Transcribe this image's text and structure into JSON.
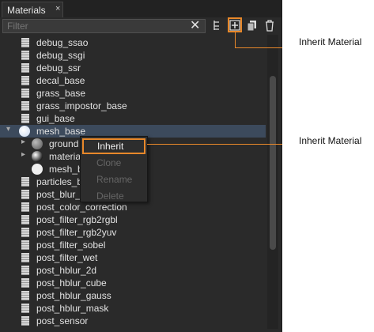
{
  "panel": {
    "tab_title": "Materials",
    "tab_close": "×"
  },
  "filter": {
    "placeholder": "Filter",
    "clear": "✕"
  },
  "materials": [
    {
      "name": "debug_ssao"
    },
    {
      "name": "debug_ssgi"
    },
    {
      "name": "debug_ssr"
    },
    {
      "name": "decal_base"
    },
    {
      "name": "grass_base"
    },
    {
      "name": "grass_impostor_base"
    },
    {
      "name": "gui_base"
    },
    {
      "name": "mesh_base",
      "expanded": true,
      "selected": true
    },
    {
      "name": "ground",
      "child": true
    },
    {
      "name": "materia",
      "child": true
    },
    {
      "name": "mesh_b",
      "child": true
    },
    {
      "name": "particles_b"
    },
    {
      "name": "post_blur_"
    },
    {
      "name": "post_color_correction"
    },
    {
      "name": "post_filter_rgb2rgbl"
    },
    {
      "name": "post_filter_rgb2yuv"
    },
    {
      "name": "post_filter_sobel"
    },
    {
      "name": "post_filter_wet"
    },
    {
      "name": "post_hblur_2d"
    },
    {
      "name": "post_hblur_cube"
    },
    {
      "name": "post_hblur_gauss"
    },
    {
      "name": "post_hblur_mask"
    },
    {
      "name": "post_sensor"
    }
  ],
  "context_menu": {
    "inherit": "Inherit",
    "clone": "Clone",
    "rename": "Rename",
    "delete": "Delete"
  },
  "callouts": {
    "toolbar": "Inherit Material",
    "menu": "Inherit Material"
  },
  "colors": {
    "accent": "#e8882a",
    "selection": "#3c4a5c"
  }
}
